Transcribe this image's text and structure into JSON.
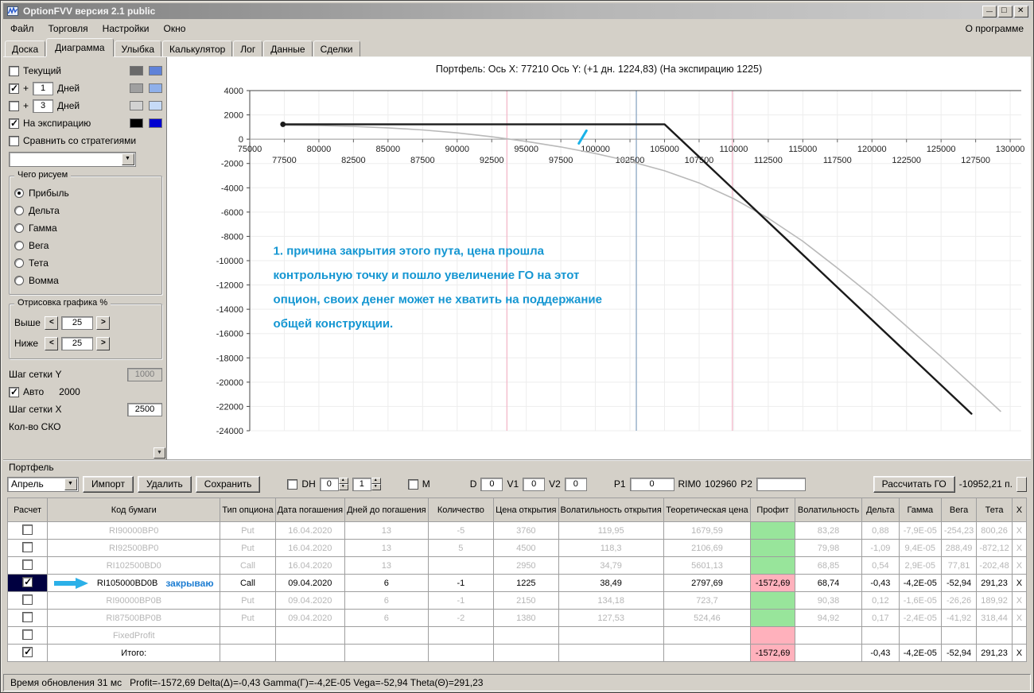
{
  "palette": {
    "profit_positive_bg": "#98e59b",
    "profit_negative_bg": "#ffb1bc",
    "selected_cell_bg": "#000040",
    "arrow_cyan": "#2bb0e8",
    "note_blue": "#1d7dd2",
    "dim_text": "#b6b6b6"
  },
  "window": {
    "title": "OptionFVV версия 2.1 public",
    "about_label": "О программе"
  },
  "menu": {
    "items": [
      "Файл",
      "Торговля",
      "Настройки",
      "Окно"
    ]
  },
  "tabs": {
    "items": [
      "Доска",
      "Диаграмма",
      "Улыбка",
      "Калькулятор",
      "Лог",
      "Данные",
      "Сделки"
    ],
    "active": "Диаграмма"
  },
  "left_panel": {
    "curves": [
      {
        "label": "Текущий",
        "checked": false,
        "sw1": "#6a6a6a",
        "sw2": "#5f82d8"
      },
      {
        "prefix": "+",
        "value": "1",
        "label": "Дней",
        "checked": true,
        "sw1": "#a0a0a0",
        "sw2": "#8fb0ea"
      },
      {
        "prefix": "+",
        "value": "3",
        "label": "Дней",
        "checked": false,
        "sw1": "#d2d2d2",
        "sw2": "#c6daf6"
      },
      {
        "label": "На экспирацию",
        "checked": true,
        "sw1": "#000000",
        "sw2": "#0000d0"
      }
    ],
    "compare_label": "Сравнить со стратегиями",
    "strategy_combo_value": "",
    "draw_group": {
      "title": "Чего рисуем",
      "options": [
        "Прибыль",
        "Дельта",
        "Гамма",
        "Вега",
        "Тета",
        "Вомма"
      ],
      "selected": "Прибыль"
    },
    "render_group": {
      "title": "Отрисовка графика %",
      "rows": [
        {
          "label": "Выше",
          "value": "25"
        },
        {
          "label": "Ниже",
          "value": "25"
        }
      ]
    },
    "grid": {
      "y_label": "Шаг сетки Y",
      "y_value": "1000",
      "auto_label": "Авто",
      "auto_checked": true,
      "auto_value": "2000",
      "x_label": "Шаг сетки X",
      "x_value": "2500",
      "sko_label": "Кол-во СКО"
    }
  },
  "chart_data": {
    "type": "line",
    "title": "Портфель: Ось X: 77210 Ось Y:  (+1 дн. 1224,83)  (На экспирацию 1225)",
    "xlim": [
      75000,
      130800
    ],
    "ylim": [
      -24000,
      4000
    ],
    "grid": true,
    "y_ticks": [
      4000,
      2000,
      0,
      -2000,
      -4000,
      -6000,
      -8000,
      -10000,
      -12000,
      -14000,
      -16000,
      -18000,
      -20000,
      -22000,
      -24000
    ],
    "x_ticks_row1": [
      75000,
      80000,
      85000,
      90000,
      95000,
      100000,
      105000,
      110000,
      115000,
      120000,
      125000,
      130000
    ],
    "x_ticks_row2": [
      77500,
      82500,
      87500,
      92500,
      97500,
      102500,
      107500,
      112500,
      117500,
      122500,
      127500
    ],
    "series": [
      {
        "name": "+1 дней",
        "color": "#b9b9b9",
        "width": 1.6,
        "points": [
          [
            77400,
            1150
          ],
          [
            80000,
            1120
          ],
          [
            82500,
            1050
          ],
          [
            85000,
            930
          ],
          [
            87500,
            760
          ],
          [
            90000,
            520
          ],
          [
            92500,
            200
          ],
          [
            95000,
            -180
          ],
          [
            97500,
            -640
          ],
          [
            100000,
            -1180
          ],
          [
            102500,
            -1820
          ],
          [
            105000,
            -2600
          ],
          [
            107500,
            -3600
          ],
          [
            110000,
            -4900
          ],
          [
            112500,
            -6500
          ],
          [
            115000,
            -8400
          ],
          [
            117500,
            -10600
          ],
          [
            120000,
            -12900
          ],
          [
            122500,
            -15400
          ],
          [
            125000,
            -17900
          ],
          [
            127500,
            -20500
          ],
          [
            129300,
            -22400
          ]
        ]
      },
      {
        "name": "На экспирацию",
        "color": "#1a1a1a",
        "width": 2.4,
        "start_dot": true,
        "points": [
          [
            77400,
            1225
          ],
          [
            105000,
            1225
          ],
          [
            127200,
            -22600
          ]
        ]
      }
    ],
    "vlines": [
      {
        "x": 93600,
        "color": "#f3b9ca"
      },
      {
        "x": 102960,
        "color": "#8ba6c3"
      },
      {
        "x": 109900,
        "color": "#f3b9ca"
      }
    ],
    "marker": {
      "x1": 98800,
      "y1": -350,
      "x2": 99350,
      "y2": 700,
      "color": "#19b2e8"
    },
    "annotation": {
      "x": 76700,
      "y": -9500,
      "line_step": 2000,
      "color": "#1496d2",
      "lines": [
        "1. причина закрытия этого пута, цена прошла",
        "контрольную точку и пошло увеличение ГО на этот",
        "опцион, своих денег может не хватить на поддержание",
        "общей конструкции."
      ]
    }
  },
  "portfolio": {
    "group_label": "Портфель",
    "month_value": "Апрель",
    "import_label": "Импорт",
    "delete_label": "Удалить",
    "save_label": "Сохранить",
    "dh_label": "DH",
    "dh_spin1": "0",
    "dh_spin2": "1",
    "m_label": "М",
    "d_label": "D",
    "d_value": "0",
    "v1_label": "V1",
    "v1_value": "0",
    "v2_label": "V2",
    "v2_value": "0",
    "p1_label": "P1",
    "p1_value": "0",
    "rim_label": "RIM0",
    "rim_value": "102960",
    "p2_label": "P2",
    "p2_value": "",
    "calc_button": "Рассчитать ГО",
    "margin_value": "-10952,21 п.",
    "table": {
      "headers": [
        "Расчет",
        "Код бумаги",
        "Тип опциона",
        "Дата погашения",
        "Дней до погашения",
        "Количество",
        "Цена открытия",
        "Волатильность открытия",
        "Теоретическая цена",
        "Профит",
        "Волатильность",
        "Дельта",
        "Гамма",
        "Вега",
        "Тета",
        "X"
      ],
      "rows": [
        {
          "checked": false,
          "dim": true,
          "code": "RI90000BP0",
          "type": "Put",
          "date": "16.04.2020",
          "days": "13",
          "qty": "-5",
          "open_price": "3760",
          "open_vol": "119,95",
          "theo": "1679,59",
          "profit": "",
          "profit_state": "positive",
          "vol": "83,28",
          "delta": "0,88",
          "gamma": "-7,9E-05",
          "vega": "-254,23",
          "theta": "800,26",
          "x": "X"
        },
        {
          "checked": false,
          "dim": true,
          "code": "RI92500BP0",
          "type": "Put",
          "date": "16.04.2020",
          "days": "13",
          "qty": "5",
          "open_price": "4500",
          "open_vol": "118,3",
          "theo": "2106,69",
          "profit": "",
          "profit_state": "positive",
          "vol": "79,98",
          "delta": "-1,09",
          "gamma": "9,4E-05",
          "vega": "288,49",
          "theta": "-872,12",
          "x": "X"
        },
        {
          "checked": false,
          "dim": true,
          "code": "RI102500BD0",
          "type": "Call",
          "date": "16.04.2020",
          "days": "13",
          "qty": "",
          "open_price": "2950",
          "open_vol": "34,79",
          "theo": "5601,13",
          "profit": "",
          "profit_state": "positive",
          "vol": "68,85",
          "delta": "0,54",
          "gamma": "2,9E-05",
          "vega": "77,81",
          "theta": "-202,48",
          "x": "X"
        },
        {
          "checked": true,
          "dim": false,
          "selected": true,
          "arrow": true,
          "note": "закрываю",
          "code": "RI105000BD0B",
          "type": "Call",
          "date": "09.04.2020",
          "days": "6",
          "qty": "-1",
          "open_price": "1225",
          "open_vol": "38,49",
          "theo": "2797,69",
          "profit": "-1572,69",
          "profit_state": "negative",
          "vol": "68,74",
          "delta": "-0,43",
          "gamma": "-4,2E-05",
          "vega": "-52,94",
          "theta": "291,23",
          "x": "X"
        },
        {
          "checked": false,
          "dim": true,
          "code": "RI90000BP0B",
          "type": "Put",
          "date": "09.04.2020",
          "days": "6",
          "qty": "-1",
          "open_price": "2150",
          "open_vol": "134,18",
          "theo": "723,7",
          "profit": "",
          "profit_state": "positive",
          "vol": "90,38",
          "delta": "0,12",
          "gamma": "-1,6E-05",
          "vega": "-26,26",
          "theta": "189,92",
          "x": "X"
        },
        {
          "checked": false,
          "dim": true,
          "code": "RI87500BP0B",
          "type": "Put",
          "date": "09.04.2020",
          "days": "6",
          "qty": "-2",
          "open_price": "1380",
          "open_vol": "127,53",
          "theo": "524,46",
          "profit": "",
          "profit_state": "positive",
          "vol": "94,92",
          "delta": "0,17",
          "gamma": "-2,4E-05",
          "vega": "-41,92",
          "theta": "318,44",
          "x": "X"
        },
        {
          "checked": false,
          "dim": true,
          "code": "FixedProfit",
          "type": "",
          "date": "",
          "days": "",
          "qty": "",
          "open_price": "",
          "open_vol": "",
          "theo": "",
          "profit": "",
          "profit_state": "negative",
          "vol": "",
          "delta": "",
          "gamma": "",
          "vega": "",
          "theta": "",
          "x": ""
        },
        {
          "checked": true,
          "dim": false,
          "code": "Итого:",
          "type": "",
          "date": "",
          "days": "",
          "qty": "",
          "open_price": "",
          "open_vol": "",
          "theo": "",
          "profit": "-1572,69",
          "profit_state": "negative",
          "vol": "",
          "delta": "-0,43",
          "gamma": "-4,2E-05",
          "vega": "-52,94",
          "theta": "291,23",
          "x": "X"
        }
      ]
    }
  },
  "statusbar": {
    "text": "Время обновления 31 мс   Profit=-1572,69 Delta(Δ)=-0,43 Gamma(Γ)=-4,2E-05 Vega=-52,94 Theta(Θ)=291,23"
  }
}
